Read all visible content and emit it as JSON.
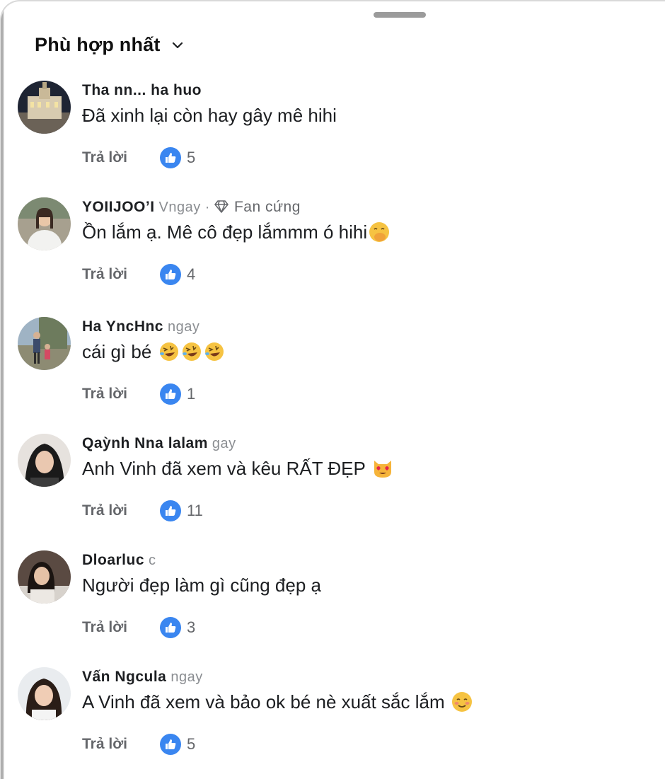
{
  "sheet": {
    "sort_label": "Phù hợp nhất"
  },
  "comments": [
    {
      "author": "Tha nn... ha huo",
      "meta": "",
      "badge": "",
      "text": "Đã xinh lại còn hay gây mê hihi",
      "emoji": [],
      "reply_label": "Trả lời",
      "likes": "5"
    },
    {
      "author": "YOIIJOO’I",
      "meta": "Vngay ·",
      "badge": "Fan cứng",
      "text": "Ồn lắm ạ. Mê cô đẹp lắmmm ó hihi",
      "emoji": [
        "hand-over-mouth-emoji"
      ],
      "reply_label": "Trả lời",
      "likes": "4"
    },
    {
      "author": "Ha YncHnc",
      "meta": "ngay",
      "badge": "",
      "text": "cái gì bé",
      "emoji": [
        "rolling-laughing-emoji",
        "rolling-laughing-emoji",
        "rolling-laughing-emoji"
      ],
      "reply_label": "Trả lời",
      "likes": "1"
    },
    {
      "author": "Qaỳnh Nna lalam",
      "meta": "gay",
      "badge": "",
      "text": "Anh Vinh đã xem và kêu RẤT ĐẸP",
      "emoji": [
        "heart-eyes-cat-emoji"
      ],
      "reply_label": "Trả lời",
      "likes": "11"
    },
    {
      "author": "Dloarluc",
      "meta": "c",
      "badge": "",
      "text": "Người đẹp làm gì cũng đẹp ạ",
      "emoji": [],
      "reply_label": "Trả lời",
      "likes": "3"
    },
    {
      "author": "Vấn Ngcula",
      "meta": "ngay",
      "badge": "",
      "text": "A Vinh đã xem và bảo ok bé nè xuất sắc lắm",
      "emoji": [
        "smiling-blush-emoji"
      ],
      "reply_label": "Trả lời",
      "likes": "5"
    }
  ]
}
